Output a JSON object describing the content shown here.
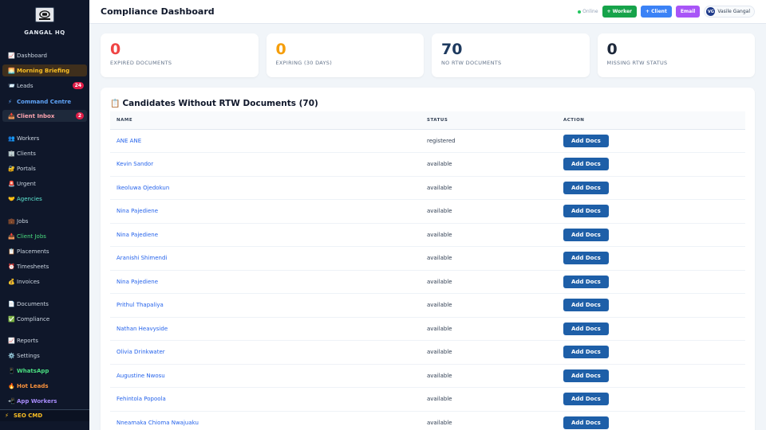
{
  "brand": {
    "name": "GANGAL HQ",
    "logo_text": "GANGAL"
  },
  "sidebar": {
    "items": [
      {
        "icon": "📈",
        "label": "Dashboard",
        "style": ""
      },
      {
        "icon": "🌅",
        "label": "Morning Briefing",
        "style": "highlight"
      },
      {
        "icon": "📨",
        "label": "Leads",
        "style": "",
        "badge": "24"
      },
      {
        "icon": "⚡",
        "label": "Command Centre",
        "style": "bold c-blue"
      },
      {
        "icon": "📥",
        "label": "Client Inbox",
        "style": "bold c-pink inbox",
        "badge": "2"
      },
      {
        "icon": "👥",
        "label": "Workers",
        "style": ""
      },
      {
        "icon": "🏢",
        "label": "Clients",
        "style": ""
      },
      {
        "icon": "🔐",
        "label": "Portals",
        "style": ""
      },
      {
        "icon": "🚨",
        "label": "Urgent",
        "style": ""
      },
      {
        "icon": "🤝",
        "label": "Agencies",
        "style": "c-teal"
      },
      {
        "icon": "💼",
        "label": "Jobs",
        "style": ""
      },
      {
        "icon": "📥",
        "label": "Client Jobs",
        "style": "c-green"
      },
      {
        "icon": "📋",
        "label": "Placements",
        "style": ""
      },
      {
        "icon": "⏰",
        "label": "Timesheets",
        "style": ""
      },
      {
        "icon": "💰",
        "label": "Invoices",
        "style": ""
      },
      {
        "icon": "📄",
        "label": "Documents",
        "style": ""
      },
      {
        "icon": "✅",
        "label": "Compliance",
        "style": ""
      },
      {
        "icon": "📈",
        "label": "Reports",
        "style": ""
      },
      {
        "icon": "⚙️",
        "label": "Settings",
        "style": ""
      },
      {
        "icon": "📱",
        "label": "WhatsApp",
        "style": "bold c-green"
      },
      {
        "icon": "🔥",
        "label": "Hot Leads",
        "style": "bold c-orange"
      },
      {
        "icon": "📲",
        "label": "App Workers",
        "style": "bold c-purple"
      }
    ],
    "seo": {
      "icon": "⚡",
      "label": "SEO CMD"
    }
  },
  "header": {
    "title": "Compliance Dashboard",
    "status": "Online",
    "buttons": {
      "worker": "+ Worker",
      "client": "+ Client",
      "email": "Email"
    },
    "user": {
      "initials": "VG",
      "name": "Vasile Gangal"
    }
  },
  "stats": [
    {
      "value": "0",
      "label": "EXPIRED DOCUMENTS",
      "color": "#ef4444"
    },
    {
      "value": "0",
      "label": "EXPIRING (30 DAYS)",
      "color": "#f59e0b"
    },
    {
      "value": "70",
      "label": "NO RTW DOCUMENTS",
      "color": "#1e3a5f"
    },
    {
      "value": "0",
      "label": "MISSING RTW STATUS",
      "color": "#1e293b"
    }
  ],
  "panel": {
    "icon": "📋",
    "title": "Candidates Without RTW Documents (70)",
    "columns": {
      "name": "NAME",
      "status": "STATUS",
      "action": "ACTION"
    },
    "action_label": "Add Docs",
    "rows": [
      {
        "name": "ANE ANE",
        "status": "registered"
      },
      {
        "name": "Kevin Sandor",
        "status": "available"
      },
      {
        "name": "Ikeoluwa Ojedokun",
        "status": "available"
      },
      {
        "name": "Nina Pajediene",
        "status": "available"
      },
      {
        "name": "Nina Pajediene",
        "status": "available"
      },
      {
        "name": "Aranishi Shimendi",
        "status": "available"
      },
      {
        "name": "Nina Pajediene",
        "status": "available"
      },
      {
        "name": "Prithul Thapaliya",
        "status": "available"
      },
      {
        "name": "Nathan Heavyside",
        "status": "available"
      },
      {
        "name": "Olivia Drinkwater",
        "status": "available"
      },
      {
        "name": "Augustine Nwosu",
        "status": "available"
      },
      {
        "name": "Fehintola Popoola",
        "status": "available"
      },
      {
        "name": "Nneamaka Chioma Nwajuaku",
        "status": "available"
      }
    ]
  }
}
